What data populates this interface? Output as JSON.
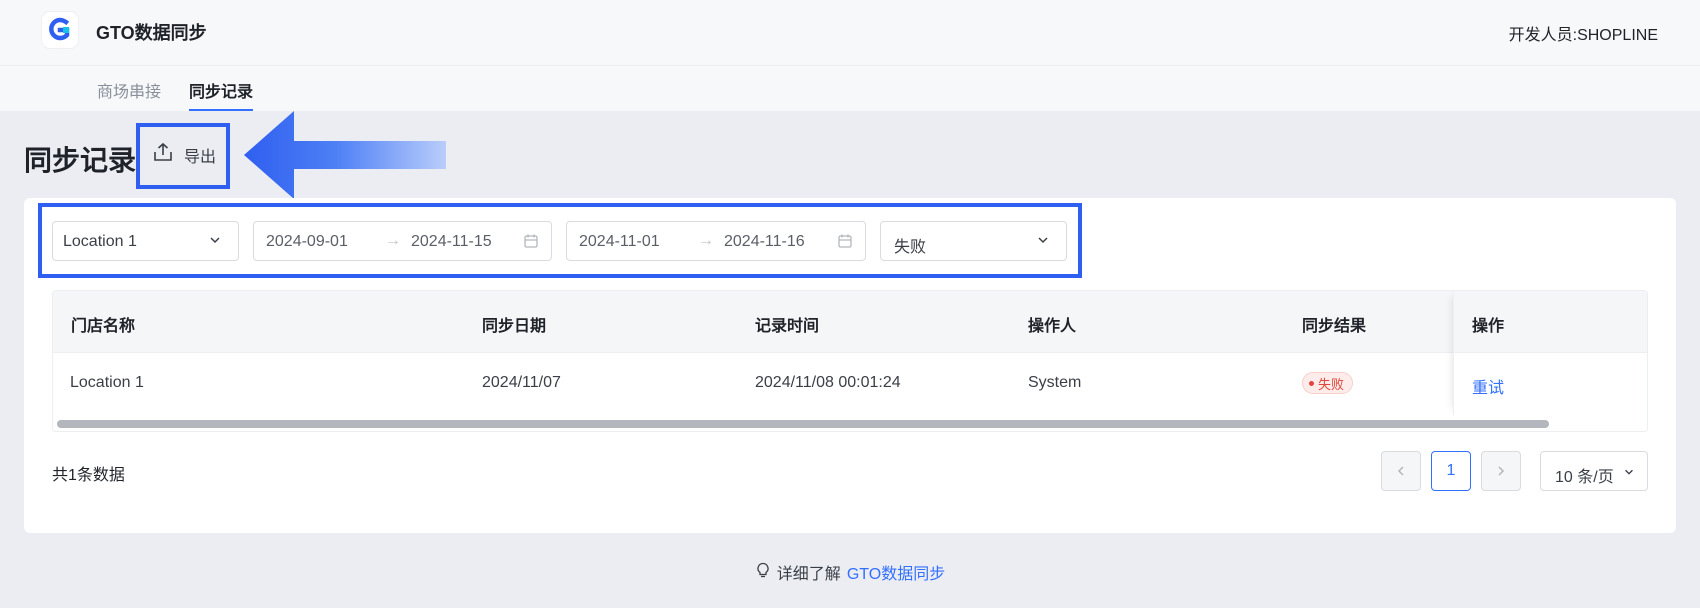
{
  "header": {
    "app_title": "GTO数据同步",
    "developer_label": "开发人员:SHOPLINE"
  },
  "tabs": [
    {
      "label": "商场串接",
      "active": false
    },
    {
      "label": "同步记录",
      "active": true
    }
  ],
  "page": {
    "title": "同步记录",
    "export_label": "导出"
  },
  "filters": {
    "location": "Location 1",
    "sync_date_range": {
      "start": "2024-09-01",
      "end": "2024-11-15"
    },
    "record_date_range": {
      "start": "2024-11-01",
      "end": "2024-11-16"
    },
    "status": "失败",
    "range_separator": "→"
  },
  "table": {
    "columns": [
      "门店名称",
      "同步日期",
      "记录时间",
      "操作人",
      "同步结果",
      "操作"
    ],
    "rows": [
      {
        "store": "Location 1",
        "sync_date": "2024/11/07",
        "record_time": "2024/11/08 00:01:24",
        "operator": "System",
        "result": "失败",
        "action": "重试"
      }
    ]
  },
  "pagination": {
    "total_text": "共1条数据",
    "current_page": "1",
    "page_size": "10 条/页"
  },
  "footer": {
    "prefix": "详细了解",
    "link": "GTO数据同步"
  },
  "colors": {
    "accent": "#3370ff",
    "highlight_border": "#2f5ff0",
    "error": "#e2453c"
  },
  "icons": [
    "logo-icon",
    "export-icon",
    "chevron-down-icon",
    "calendar-icon",
    "chevron-left-icon",
    "chevron-right-icon",
    "lightbulb-icon"
  ]
}
